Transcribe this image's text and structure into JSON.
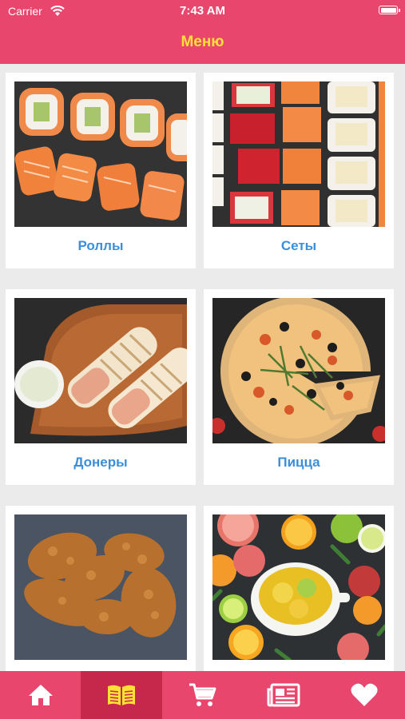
{
  "status_bar": {
    "carrier": "Carrier",
    "time": "7:43 AM"
  },
  "header": {
    "title": "Меню"
  },
  "categories": [
    {
      "label": "Роллы",
      "image": "sushi-rolls"
    },
    {
      "label": "Сеты",
      "image": "sushi-set"
    },
    {
      "label": "Донеры",
      "image": "doner-wraps"
    },
    {
      "label": "Пицца",
      "image": "pizza"
    },
    {
      "label": "",
      "image": "fried-chicken"
    },
    {
      "label": "",
      "image": "citrus-tea"
    }
  ],
  "tab_bar": {
    "tabs": [
      {
        "icon": "home-icon",
        "active": false
      },
      {
        "icon": "menu-book-icon",
        "active": true
      },
      {
        "icon": "cart-icon",
        "active": false
      },
      {
        "icon": "news-icon",
        "active": false
      },
      {
        "icon": "heart-icon",
        "active": false
      }
    ]
  },
  "colors": {
    "primary": "#e8466c",
    "active_tab": "#c5284b",
    "title": "#ffe136",
    "label": "#3a8fd8",
    "background": "#ebebeb"
  }
}
